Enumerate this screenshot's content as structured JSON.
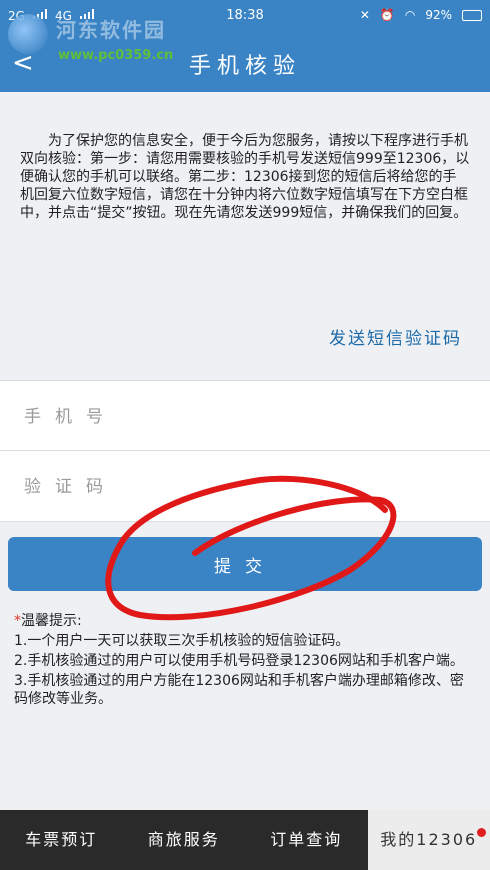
{
  "status_bar": {
    "network": "2G",
    "network2": "4G",
    "time": "18:38",
    "battery": "92%"
  },
  "header": {
    "title": "手机核验"
  },
  "watermark": {
    "name": "河东软件园",
    "url": "www.pc0359.cn"
  },
  "intro": {
    "text": "为了保护您的信息安全，便于今后为您服务，请按以下程序进行手机双向核验：第一步：请您用需要核验的手机号发送短信999至12306，以便确认您的手机可以联络。第二步：12306接到您的短信后将给您的手机回复六位数字短信，请您在十分钟内将六位数字短信填写在下方空白框中，并点击“提交”按钮。现在先请您发送999短信，并确保我们的回复。",
    "sms_link": "发送短信验证码"
  },
  "form": {
    "phone_placeholder": "手机号",
    "code_placeholder": "验证码",
    "submit_label": "提交"
  },
  "tips": {
    "title": "温馨提示:",
    "items": [
      "1.一个用户一天可以获取三次手机核验的短信验证码。",
      "2.手机核验通过的用户可以使用手机号码登录12306网站和手机客户端。",
      "3.手机核验通过的用户方能在12306网站和手机客户端办理邮箱修改、密码修改等业务。"
    ]
  },
  "bottom_nav": {
    "items": [
      {
        "label": "车票预订"
      },
      {
        "label": "商旅服务"
      },
      {
        "label": "订单查询"
      },
      {
        "label": "我的12306"
      }
    ]
  },
  "colors": {
    "primary": "#3a84c6",
    "annotation": "#e01818",
    "nav_bg": "#2a2a2a"
  }
}
